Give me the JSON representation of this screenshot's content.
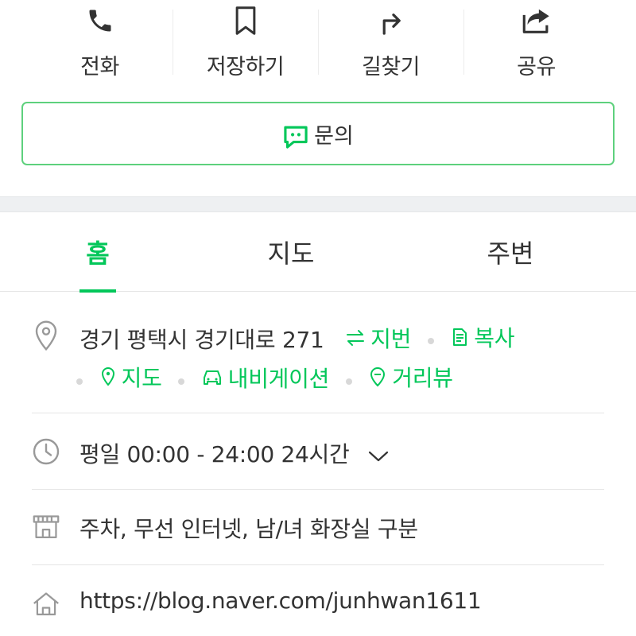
{
  "actions": {
    "call": "전화",
    "save": "저장하기",
    "directions": "길찾기",
    "share": "공유"
  },
  "inquiry": {
    "label": "문의"
  },
  "tabs": {
    "home": "홈",
    "map": "지도",
    "nearby": "주변"
  },
  "address": {
    "text": "경기 평택시 경기대로 271",
    "lot_number": "지번",
    "copy": "복사",
    "map": "지도",
    "navigation": "내비게이션",
    "street_view": "거리뷰"
  },
  "hours": {
    "text": "평일 00:00 - 24:00 24시간"
  },
  "facilities": {
    "text": "주차, 무선 인터넷, 남/녀 화장실 구분"
  },
  "homepage": {
    "url": "https://blog.naver.com/junhwan1611"
  },
  "colors": {
    "accent": "#03c75a",
    "border_accent": "#5ed17d",
    "divider": "#eef0f2"
  }
}
